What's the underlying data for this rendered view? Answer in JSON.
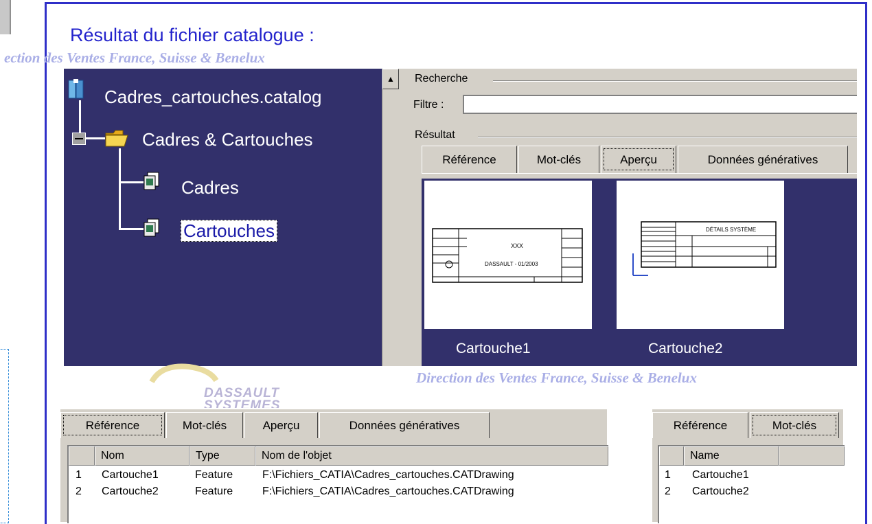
{
  "slide": {
    "title": "Résultat du fichier catalogue :",
    "watermark_top": "ection des Ventes France, Suisse & Benelux",
    "watermark_mid": "Direction des Ventes France, Suisse & Benelux",
    "logo_text_1": "DASSAULT",
    "logo_text_2": "SYSTEMES"
  },
  "tree": {
    "root": "Cadres_cartouches.catalog",
    "chapter": "Cadres & Cartouches",
    "families": [
      "Cadres",
      "Cartouches"
    ],
    "selected": "Cartouches"
  },
  "search": {
    "group_search": "Recherche",
    "filter_label": "Filtre :",
    "filter_value": "",
    "group_result": "Résultat"
  },
  "top_tabs": [
    "Référence",
    "Mot-clés",
    "Aperçu",
    "Données génératives"
  ],
  "top_tabs_active": "Aperçu",
  "previews": [
    {
      "label": "Cartouche1",
      "title_text": "XXX",
      "subtitle_text": "DASSAULT - 01/2003"
    },
    {
      "label": "Cartouche2",
      "title_text": "DÉTAILS SYSTÈME"
    }
  ],
  "bottom_left": {
    "tabs": [
      "Référence",
      "Mot-clés",
      "Aperçu",
      "Données génératives"
    ],
    "active_tab": "Référence",
    "columns": [
      "Nom",
      "Type",
      "Nom de l'objet"
    ],
    "rows": [
      {
        "index": "1",
        "nom": "Cartouche1",
        "type": "Feature",
        "objet": "F:\\Fichiers_CATIA\\Cadres_cartouches.CATDrawing"
      },
      {
        "index": "2",
        "nom": "Cartouche2",
        "type": "Feature",
        "objet": "F:\\Fichiers_CATIA\\Cadres_cartouches.CATDrawing"
      }
    ]
  },
  "bottom_right": {
    "tabs": [
      "Référence",
      "Mot-clés"
    ],
    "active_tab": "Mot-clés",
    "columns": [
      "Name"
    ],
    "rows": [
      {
        "index": "1",
        "name": "Cartouche1"
      },
      {
        "index": "2",
        "name": "Cartouche2"
      }
    ]
  },
  "colors": {
    "frame": "#2f2fc8",
    "title": "#2323cc",
    "tree_bg": "#32306b",
    "dialog_bg": "#d4d0c8",
    "watermark": "#a9aee6"
  }
}
